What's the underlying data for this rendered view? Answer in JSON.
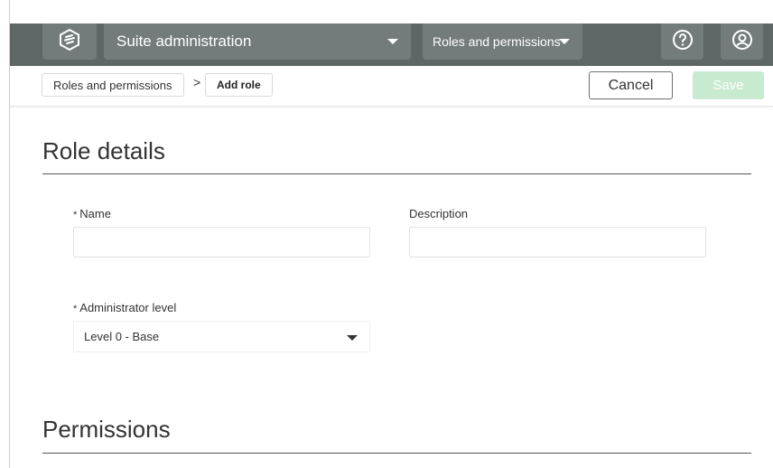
{
  "header": {
    "suite_label": "Suite administration",
    "module_label": "Roles and permissions"
  },
  "icons": {
    "logo": "logo-icon",
    "suite_caret": "chevron-down-icon",
    "module_caret": "chevron-down-icon",
    "help": "help-icon",
    "user": "user-icon"
  },
  "breadcrumb": {
    "items": [
      {
        "label": "Roles and permissions"
      },
      {
        "label": "Add role"
      }
    ],
    "separator": ">"
  },
  "actions": {
    "cancel_label": "Cancel",
    "save_label": "Save"
  },
  "role_details": {
    "title": "Role details",
    "name": {
      "label": "Name",
      "required_mark": "*",
      "value": ""
    },
    "description": {
      "label": "Description",
      "value": ""
    },
    "admin_level": {
      "label": "Administrator level",
      "required_mark": "*",
      "selected": "Level 0 - Base"
    }
  },
  "permissions": {
    "title": "Permissions"
  },
  "colors": {
    "header_bg": "#5f6766",
    "header_button_bg": "#747c7b",
    "save_disabled_bg": "#c8ebcf"
  }
}
